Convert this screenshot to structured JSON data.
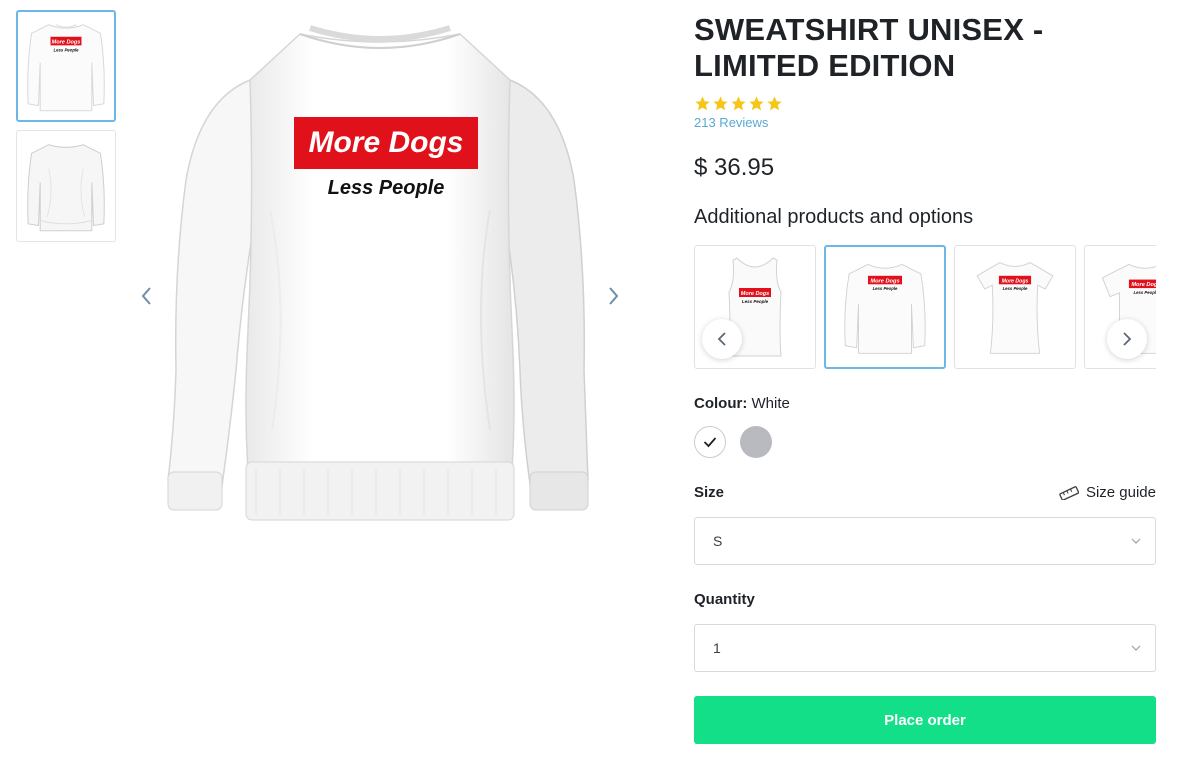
{
  "product": {
    "title": "SWEATSHIRT UNISEX - LIMITED EDITION",
    "rating": 5,
    "reviews_label": "213 Reviews",
    "price": "$ 36.95"
  },
  "design": {
    "line1": "More Dogs",
    "line2": "Less People",
    "banner_color": "#e1111b"
  },
  "additional": {
    "title": "Additional products and options",
    "items": [
      {
        "type": "tank-top",
        "selected": false
      },
      {
        "type": "sweatshirt",
        "selected": true
      },
      {
        "type": "womens-tshirt",
        "selected": false
      },
      {
        "type": "tshirt",
        "selected": false
      }
    ]
  },
  "colour": {
    "label": "Colour:",
    "value": "White",
    "options": [
      {
        "name": "White",
        "hex": "#ffffff",
        "selected": true
      },
      {
        "name": "Grey",
        "hex": "#b9bac0",
        "selected": false
      }
    ]
  },
  "size": {
    "label": "Size",
    "guide_label": "Size guide",
    "value": "S"
  },
  "quantity": {
    "label": "Quantity",
    "value": "1"
  },
  "order": {
    "label": "Place order",
    "color": "#13df88"
  },
  "colors": {
    "accent": "#6bb8e8",
    "star": "#f5c518",
    "link": "#5aa9d6"
  }
}
